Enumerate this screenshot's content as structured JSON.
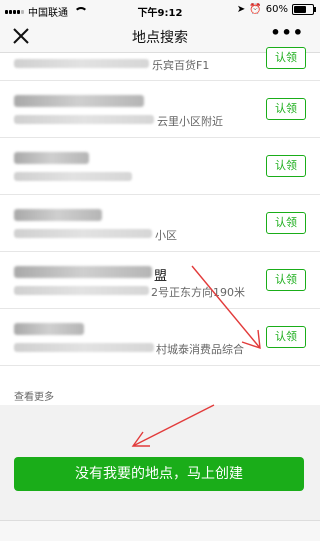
{
  "status_bar": {
    "carrier": "中国联通",
    "time": "下午9:12",
    "battery": "60%",
    "battery_level": 0.6
  },
  "navbar": {
    "title": "地点搜索",
    "more": "•••",
    "close_icon": "close-icon"
  },
  "list": {
    "claim_label": "认领",
    "items": [
      {
        "name_tail": "",
        "addr_tail": "乐宾百货F1"
      },
      {
        "name_tail": "",
        "addr_tail": "云里小区附近"
      },
      {
        "name_tail": "",
        "addr_tail": ""
      },
      {
        "name_tail": "",
        "addr_tail": "小区"
      },
      {
        "name_tail": "盟",
        "addr_tail": "2号正东方向190米"
      },
      {
        "name_tail": "",
        "addr_tail": "村城泰消费品综合"
      }
    ]
  },
  "see_more": "查看更多",
  "create_button": "没有我要的地点，马上创建",
  "colors": {
    "accent": "#1aad19",
    "annotation_arrow": "#e23b3b"
  }
}
